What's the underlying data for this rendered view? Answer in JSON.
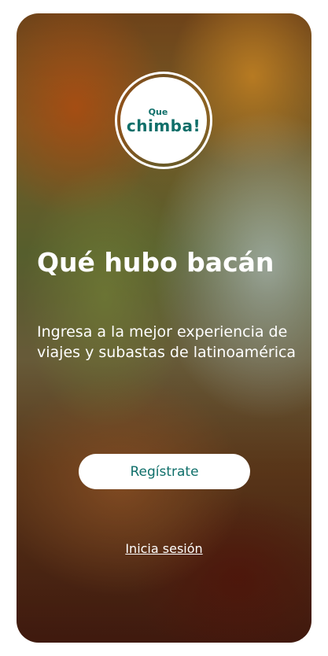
{
  "logo": {
    "small_text": "Que",
    "big_text": "chimba!"
  },
  "welcome": {
    "title": "Qué hubo bacán",
    "subtitle": "Ingresa a la mejor experiencia de viajes y subastas de latinoamérica"
  },
  "actions": {
    "register_label": "Regístrate",
    "login_label": "Inicia sesión"
  },
  "colors": {
    "brand": "#0f6f6a",
    "button_bg": "#ffffff",
    "text": "#ffffff"
  },
  "background": {
    "icon": "autumn-forest-path-photo"
  }
}
